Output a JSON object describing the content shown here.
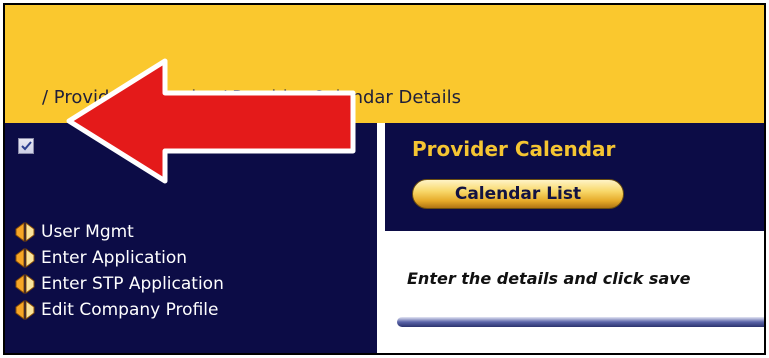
{
  "breadcrumb": {
    "text": "/ Provider Calendar / Provider Calendar Details"
  },
  "sidebar": {
    "menu": [
      {
        "label": "User Mgmt"
      },
      {
        "label": "Enter Application"
      },
      {
        "label": "Enter STP Application"
      },
      {
        "label": "Edit Company Profile"
      }
    ]
  },
  "main": {
    "title": "Provider Calendar",
    "calendar_list_button": "Calendar List",
    "instructions": "Enter the details and click save"
  },
  "colors": {
    "header_bg": "#fac82e",
    "sidebar_bg": "#0c0c46",
    "title_gold": "#f5c532",
    "annotation_arrow": "#e41a1a"
  },
  "annotation": {
    "icon": "red-arrow-left"
  },
  "icons": {
    "menu_item": "book-icon",
    "checkbox": "check-icon"
  }
}
